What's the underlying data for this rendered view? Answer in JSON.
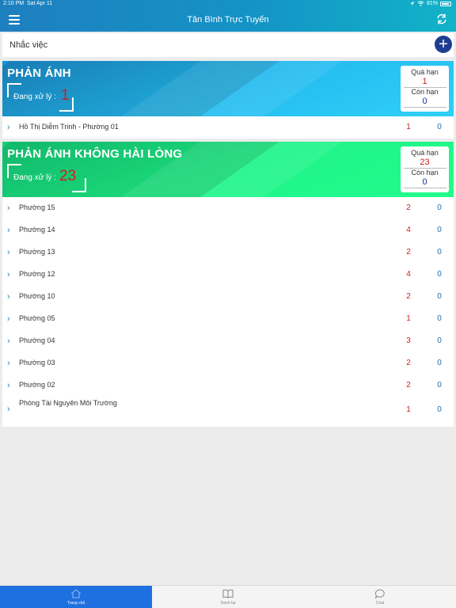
{
  "status_bar": {
    "time": "2:10 PM",
    "date": "Sat Apr 11",
    "battery": "81%"
  },
  "header": {
    "title": "Tân Bình Trực Tuyến",
    "menu_icon": "menu-icon",
    "refresh_icon": "refresh-icon"
  },
  "reminder": {
    "label": "Nhắc việc",
    "add_icon": "plus-icon"
  },
  "section1": {
    "title": "PHẢN ÁNH",
    "processing_label": "Đang xử lý :",
    "processing_count": "1",
    "overdue_label": "Quá hạn",
    "overdue_count": "1",
    "remaining_label": "Còn hạn",
    "remaining_count": "0",
    "rows": [
      {
        "name": "Hồ Thị Diễm Trinh - Phường 01",
        "overdue": "1",
        "remaining": "0"
      }
    ]
  },
  "section2": {
    "title": "PHẢN ÁNH KHÔNG HÀI LÒNG",
    "processing_label": "Đang xử lý :",
    "processing_count": "23",
    "overdue_label": "Quá hạn",
    "overdue_count": "23",
    "remaining_label": "Còn hạn",
    "remaining_count": "0",
    "rows": [
      {
        "name": "Phường 15",
        "overdue": "2",
        "remaining": "0"
      },
      {
        "name": "Phường 14",
        "overdue": "4",
        "remaining": "0"
      },
      {
        "name": "Phường 13",
        "overdue": "2",
        "remaining": "0"
      },
      {
        "name": "Phường 12",
        "overdue": "4",
        "remaining": "0"
      },
      {
        "name": "Phường 10",
        "overdue": "2",
        "remaining": "0"
      },
      {
        "name": "Phường 05",
        "overdue": "1",
        "remaining": "0"
      },
      {
        "name": "Phường 04",
        "overdue": "3",
        "remaining": "0"
      },
      {
        "name": "Phường 03",
        "overdue": "2",
        "remaining": "0"
      },
      {
        "name": "Phường 02",
        "overdue": "2",
        "remaining": "0"
      },
      {
        "name": "Phòng Tài Nguyên Môi Trường",
        "overdue": "1",
        "remaining": "0"
      }
    ]
  },
  "tabs": [
    {
      "label": "Trang chủ",
      "icon": "home-icon",
      "active": true
    },
    {
      "label": "Danh bạ",
      "icon": "book-icon",
      "active": false
    },
    {
      "label": "Chat",
      "icon": "chat-bubble-icon",
      "active": false
    }
  ],
  "colors": {
    "header": "#1493c6",
    "section1": "#22b6ee",
    "section2": "#1ff48a",
    "overdue": "#d51b1b",
    "remaining": "#1d6fb0",
    "active_tab": "#1e6fe0"
  }
}
